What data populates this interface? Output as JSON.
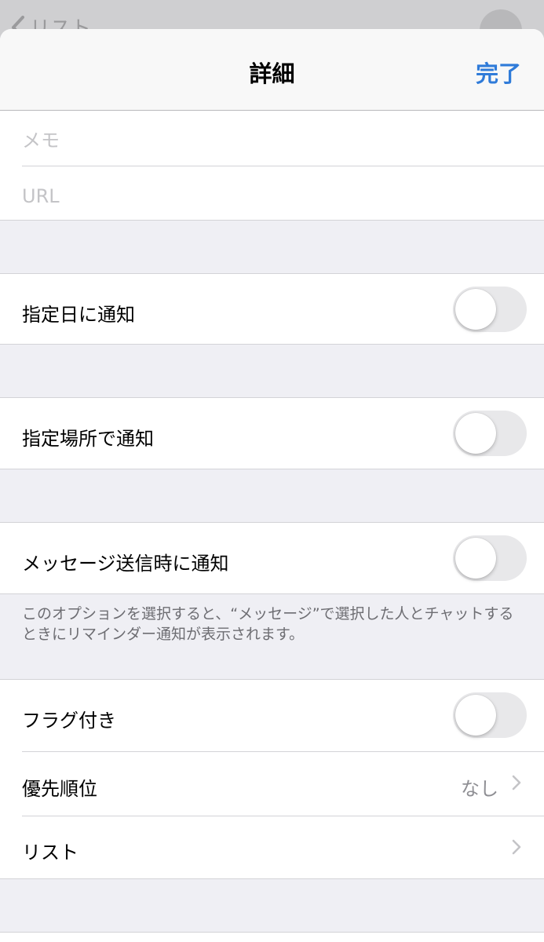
{
  "background_screen": {
    "back_label": "リスト"
  },
  "nav": {
    "title": "詳細",
    "done_label": "完了"
  },
  "fields": {
    "memo_placeholder": "メモ",
    "url_placeholder": "URL"
  },
  "alerts": {
    "date_label": "指定日に通知",
    "date_on": false,
    "location_label": "指定場所で通知",
    "location_on": false,
    "message_label": "メッセージ送信時に通知",
    "message_on": false,
    "message_footnote": "このオプションを選択すると、“メッセージ”で選択した人とチャットするときにリマインダー通知が表示されます。"
  },
  "details": {
    "flag_label": "フラグ付き",
    "flag_on": false,
    "priority_label": "優先順位",
    "priority_value": "なし",
    "list_label": "リスト"
  },
  "colors": {
    "accent": "#2f7bd9",
    "grouped_bg": "#efeff4",
    "separator": "#d3d3d7"
  }
}
